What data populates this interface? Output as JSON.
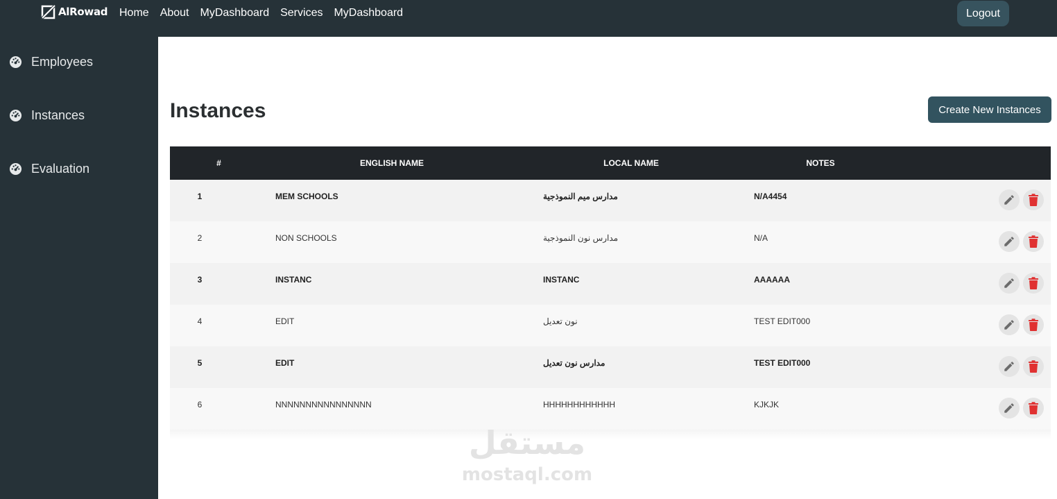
{
  "brand": {
    "name": "AlRowad"
  },
  "nav": {
    "items": [
      "Home",
      "About",
      "MyDashboard",
      "Services",
      "MyDashboard"
    ]
  },
  "header": {
    "logout_label": "Logout"
  },
  "sidebar": {
    "items": [
      {
        "label": "Employees",
        "icon": "dashboard-gauge-icon"
      },
      {
        "label": "Instances",
        "icon": "dashboard-gauge-icon"
      },
      {
        "label": "Evaluation",
        "icon": "dashboard-gauge-icon"
      }
    ]
  },
  "page": {
    "title": "Instances",
    "create_label": "Create New Instances"
  },
  "table": {
    "columns": [
      "#",
      "ENGLISH NAME",
      "LOCAL NAME",
      "NOTES"
    ],
    "rows": [
      {
        "num": "1",
        "english": "MEM SCHOOLS",
        "local": "مدارس ميم النموذجية",
        "notes": "N/A4454"
      },
      {
        "num": "2",
        "english": "NON SCHOOLS",
        "local": "مدارس نون النموذجية",
        "notes": "N/A"
      },
      {
        "num": "3",
        "english": "INSTANC",
        "local": "INSTANC",
        "notes": "AAAAAA"
      },
      {
        "num": "4",
        "english": "EDIT",
        "local": "نون تعديل",
        "notes": "TEST EDIT000"
      },
      {
        "num": "5",
        "english": "EDIT",
        "local": "مدارس نون تعديل",
        "notes": "TEST EDIT000"
      },
      {
        "num": "6",
        "english": "NNNNNNNNNNNNNNNN",
        "local": "HHHHHHHHHHHH",
        "notes": "KJKJK"
      }
    ]
  },
  "watermark": {
    "arabic": "مستقل",
    "latin": "mostaql.com"
  },
  "colors": {
    "topbar": "#263238",
    "sidebar": "#263238",
    "primary_button": "#32535f",
    "delete_icon": "#e03131",
    "edit_icon": "#6c6c6c"
  }
}
